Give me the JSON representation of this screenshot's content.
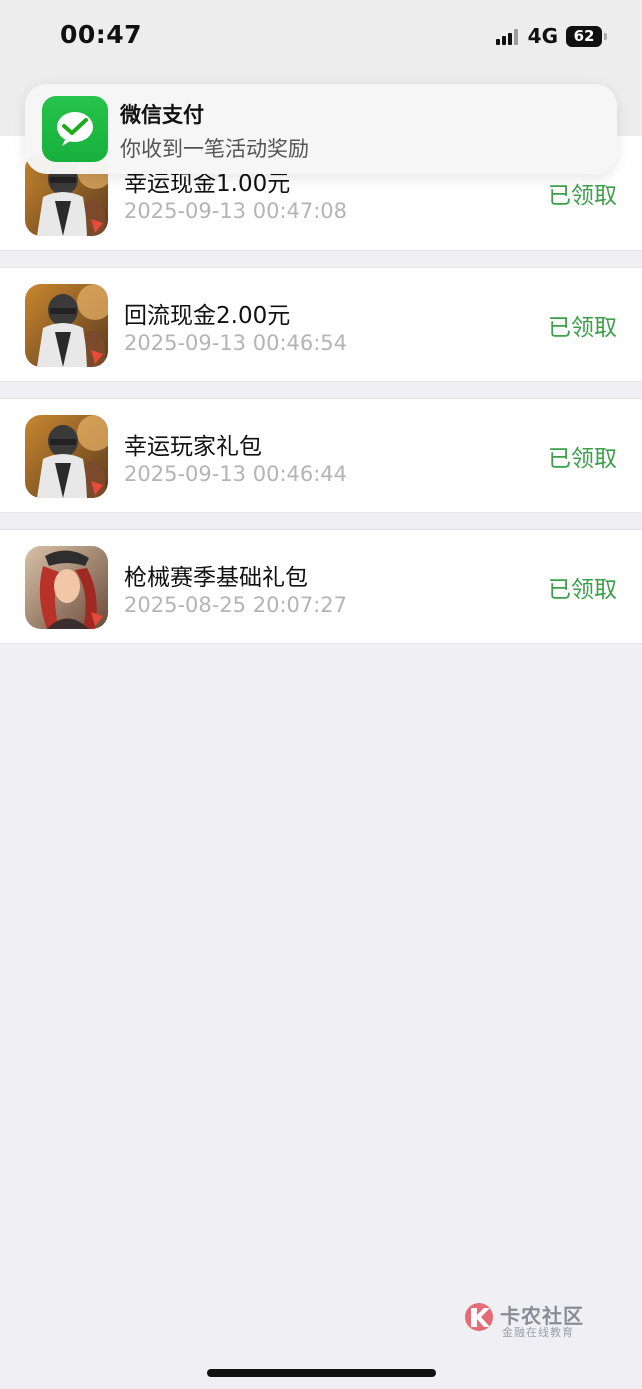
{
  "status_bar": {
    "time": "00:47",
    "network": "4G",
    "battery": "62"
  },
  "notification": {
    "app": "微信支付",
    "message": "你收到一笔活动奖励",
    "icon": "wechat-pay-icon"
  },
  "records": [
    {
      "title": "幸运现金1.00元",
      "time": "2025-09-13 00:47:08",
      "status": "已领取",
      "icon": "pubg-game-icon"
    },
    {
      "title": "回流现金2.00元",
      "time": "2025-09-13 00:46:54",
      "status": "已领取",
      "icon": "pubg-game-icon"
    },
    {
      "title": "幸运玩家礼包",
      "time": "2025-09-13 00:46:44",
      "status": "已领取",
      "icon": "pubg-game-icon"
    },
    {
      "title": "枪械赛季基础礼包",
      "time": "2025-08-25 20:07:27",
      "status": "已领取",
      "icon": "character-game-icon"
    }
  ],
  "watermark": {
    "title": "卡农社区",
    "subtitle": "金融在线教育"
  },
  "colors": {
    "status_green": "#3CA04A",
    "wechat_green": "#1AAD19",
    "background": "#EFEFF4"
  }
}
